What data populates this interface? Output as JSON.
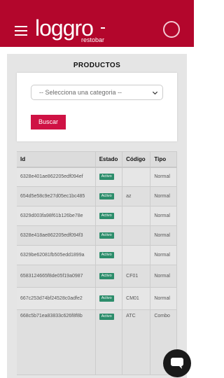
{
  "header": {
    "logo_word": "loggro",
    "logo_sub": "restobar"
  },
  "page": {
    "title": "PRODUCTOS"
  },
  "filters": {
    "category_value": "-- Selecciona una categoria --",
    "search_label": "Buscar"
  },
  "table": {
    "columns": [
      "Id",
      "Estado",
      "Código",
      "Tipo"
    ],
    "rows": [
      {
        "id": "6328e401ae862205edf094ef",
        "estado": "Activo",
        "codigo": "",
        "tipo": "Normal"
      },
      {
        "id": "654d5e58c9e27d05ec1bc485",
        "estado": "Activo",
        "codigo": "az",
        "tipo": "Normal"
      },
      {
        "id": "6329d003fa98f61b126be78e",
        "estado": "Activo",
        "codigo": "",
        "tipo": "Normal"
      },
      {
        "id": "6328e418ae862205edf094f3",
        "estado": "Activo",
        "codigo": "",
        "tipo": "Normal"
      },
      {
        "id": "6329be62081fb505edd1899a",
        "estado": "Activo",
        "codigo": "",
        "tipo": "Normal"
      },
      {
        "id": "6583124665f8de05f19a0987",
        "estado": "Activo",
        "codigo": "CF01",
        "tipo": "Normal"
      },
      {
        "id": "667c253d74bf24528c0adfe2",
        "estado": "Activo",
        "codigo": "CM01",
        "tipo": "Normal"
      },
      {
        "id": "668c5b71ea83833c626f8f8b",
        "estado": "Activo",
        "codigo": "ATC",
        "tipo": "Combo"
      }
    ]
  },
  "icons": {
    "menu": "hamburger-icon",
    "user": "user-avatar-icon",
    "select": "chevron-down-icon",
    "chat": "chat-icon"
  },
  "colors": {
    "brand": "#b3062c",
    "button": "#cf1244",
    "badge": "#2c8d6b"
  }
}
